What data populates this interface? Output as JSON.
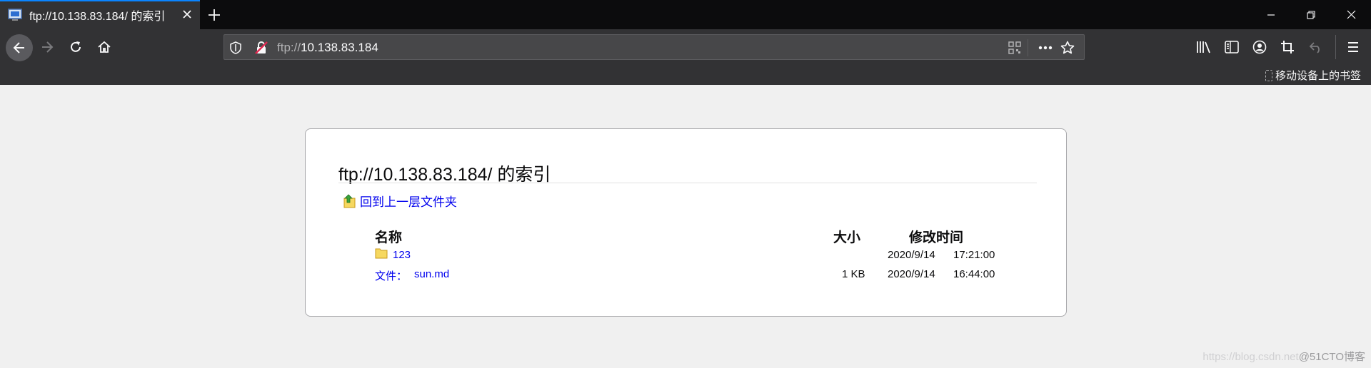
{
  "tab": {
    "title": "ftp://10.138.83.184/ 的索引"
  },
  "urlbar": {
    "scheme": "ftp://",
    "host": "10.138.83.184"
  },
  "bookmarks": {
    "mobile_label": "移动设备上的书签"
  },
  "page": {
    "heading": "ftp://10.138.83.184/ 的索引",
    "up_link": "回到上一层文件夹",
    "columns": {
      "name": "名称",
      "size": "大小",
      "modified": "修改时间"
    },
    "rows": [
      {
        "prefix": "",
        "name": "123",
        "size": "",
        "date": "2020/9/14",
        "time": "17:21:00",
        "type": "folder"
      },
      {
        "prefix": "文件：",
        "name": "sun.md",
        "size": "1 KB",
        "date": "2020/9/14",
        "time": "16:44:00",
        "type": "file"
      }
    ]
  },
  "watermark": {
    "url": "https://blog.csdn.net",
    "brand": "@51CTO博客"
  },
  "colors": {
    "tab_accent": "#0a84ff",
    "link": "#0000ee",
    "toolbar": "#323234",
    "page_bg": "#f0f0f0"
  }
}
